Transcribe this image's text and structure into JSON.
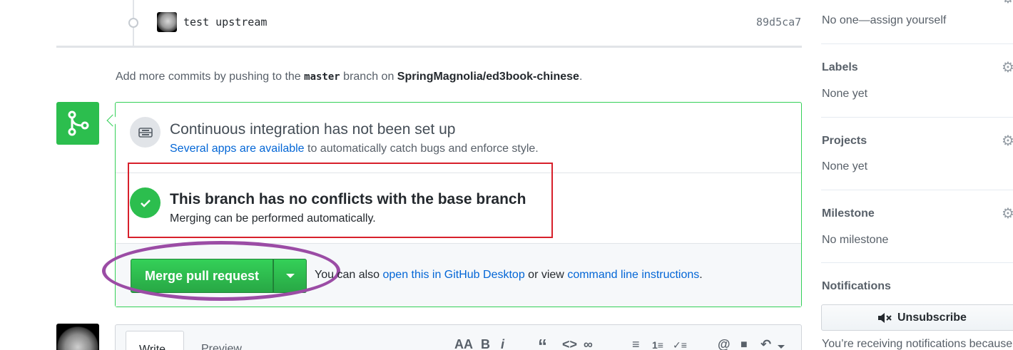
{
  "commit": {
    "message": "test upstream",
    "sha": "89d5ca7"
  },
  "push_note": {
    "prefix": "Add more commits by pushing to the",
    "branch": "master",
    "middle": "branch on",
    "repo": "SpringMagnolia/ed3book-chinese",
    "suffix": "."
  },
  "ci": {
    "title": "Continuous integration has not been set up",
    "link": "Several apps are available",
    "rest": "to automatically catch bugs and enforce style."
  },
  "conflicts": {
    "title": "This branch has no conflicts with the base branch",
    "desc": "Merging can be performed automatically."
  },
  "merge": {
    "button_label": "Merge pull request",
    "alt_prefix": "You can also",
    "alt_link1": "open this in GitHub Desktop",
    "alt_middle": "or view",
    "alt_link2": "command line instructions",
    "alt_suffix": "."
  },
  "comment": {
    "tab_write": "Write",
    "tab_preview": "Preview",
    "toolbar": [
      "AA",
      "B",
      "i",
      "“",
      "<>",
      "∞",
      "≡",
      "1≡",
      "✓≡",
      "@",
      "■",
      "↶"
    ]
  },
  "sidebar": {
    "assignees_value": "No one—assign yourself",
    "labels_heading": "Labels",
    "labels_value": "None yet",
    "projects_heading": "Projects",
    "projects_value": "None yet",
    "milestone_heading": "Milestone",
    "milestone_value": "No milestone",
    "notifications_heading": "Notifications",
    "unsubscribe_label": "Unsubscribe",
    "notifications_note": "You’re receiving notifications because"
  },
  "colors": {
    "success_green": "#2cbe4e",
    "link_blue": "#0366d6",
    "highlight_red": "#d7202b",
    "highlight_purple": "#9b4ca5"
  }
}
